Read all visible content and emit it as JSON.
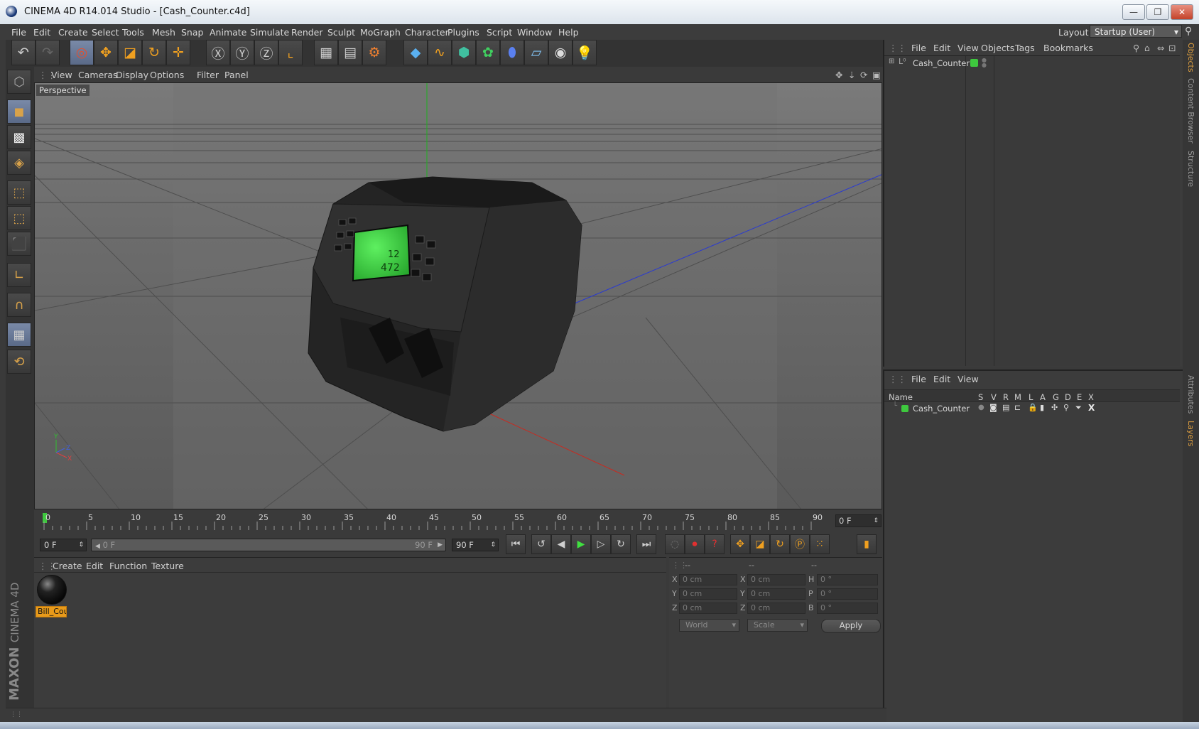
{
  "window": {
    "title": "CINEMA 4D R14.014 Studio - [Cash_Counter.c4d]"
  },
  "menubar": {
    "items": [
      "File",
      "Edit",
      "Create",
      "Select",
      "Tools",
      "Mesh",
      "Snap",
      "Animate",
      "Simulate",
      "Render",
      "Sculpt",
      "MoGraph",
      "Character",
      "Plugins",
      "Script",
      "Window",
      "Help"
    ],
    "layout_label": "Layout:",
    "layout_value": "Startup (User)"
  },
  "viewport": {
    "menu": [
      "View",
      "Cameras",
      "Display",
      "Options",
      "Filter",
      "Panel"
    ],
    "label": "Perspective",
    "lcd_line1": "12",
    "lcd_line2": "472"
  },
  "timeline": {
    "ticks": [
      "0",
      "5",
      "10",
      "15",
      "20",
      "25",
      "30",
      "35",
      "40",
      "45",
      "50",
      "55",
      "60",
      "65",
      "70",
      "75",
      "80",
      "85",
      "90"
    ],
    "current_frame": "0 F",
    "start_field": "0 F",
    "range_start": "0 F",
    "range_end": "90 F",
    "end_field": "90 F"
  },
  "materials": {
    "menu": [
      "Create",
      "Edit",
      "Function",
      "Texture"
    ],
    "items": [
      {
        "name": "Bill_Cou"
      }
    ]
  },
  "coordinates": {
    "headers": [
      "--",
      "--",
      "--"
    ],
    "rows": [
      {
        "l1": "X",
        "v1": "0 cm",
        "l2": "X",
        "v2": "0 cm",
        "l3": "H",
        "v3": "0 °"
      },
      {
        "l1": "Y",
        "v1": "0 cm",
        "l2": "Y",
        "v2": "0 cm",
        "l3": "P",
        "v3": "0 °"
      },
      {
        "l1": "Z",
        "v1": "0 cm",
        "l2": "Z",
        "v2": "0 cm",
        "l3": "B",
        "v3": "0 °"
      }
    ],
    "mode": "World",
    "scale_mode": "Scale",
    "apply": "Apply"
  },
  "object_manager": {
    "menu": [
      "File",
      "Edit",
      "View",
      "Objects",
      "Tags",
      "Bookmarks"
    ],
    "objects": [
      {
        "name": "Cash_Counter"
      }
    ]
  },
  "layer_manager": {
    "menu": [
      "File",
      "Edit",
      "View"
    ],
    "columns": [
      "Name",
      "S",
      "V",
      "R",
      "M",
      "L",
      "A",
      "G",
      "D",
      "E",
      "X"
    ],
    "layers": [
      {
        "name": "Cash_Counter"
      }
    ]
  },
  "side_tabs": [
    "Objects",
    "Content Browser",
    "Structure",
    "Attributes",
    "Layers"
  ],
  "logo": {
    "line1": "MAXON",
    "line2": "CINEMA 4D"
  },
  "colors": {
    "accent": "#e89a1a",
    "layer_green": "#3ec83e",
    "viewport_bg": "#6a6a6a"
  }
}
